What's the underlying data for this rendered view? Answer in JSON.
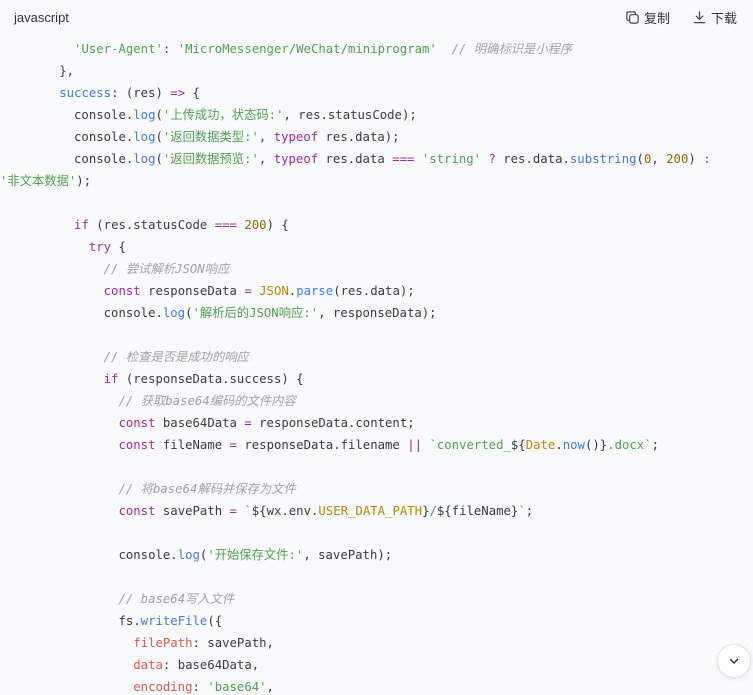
{
  "header": {
    "language": "javascript",
    "copy_label": "复制",
    "download_label": "下载"
  },
  "icons": {
    "copy": "copy-icon",
    "download": "download-icon",
    "scroll": "chevron-down-icon"
  },
  "code_lines": [
    [
      {
        "t": "          "
      },
      {
        "t": "'User-Agent'",
        "c": "s"
      },
      {
        "t": ": "
      },
      {
        "t": "'MicroMessenger/WeChat/miniprogram'",
        "c": "s"
      },
      {
        "t": "  "
      },
      {
        "t": "// 明确标识是小程序",
        "c": "c"
      }
    ],
    [
      {
        "t": "        },"
      }
    ],
    [
      {
        "t": "        "
      },
      {
        "t": "success",
        "c": "f"
      },
      {
        "t": ": (res) "
      },
      {
        "t": "=>",
        "c": "k"
      },
      {
        "t": " {"
      }
    ],
    [
      {
        "t": "          console."
      },
      {
        "t": "log",
        "c": "f"
      },
      {
        "t": "("
      },
      {
        "t": "'上传成功，状态码:'",
        "c": "s"
      },
      {
        "t": ", res.statusCode);"
      }
    ],
    [
      {
        "t": "          console."
      },
      {
        "t": "log",
        "c": "f"
      },
      {
        "t": "("
      },
      {
        "t": "'返回数据类型:'",
        "c": "s"
      },
      {
        "t": ", "
      },
      {
        "t": "typeof",
        "c": "k"
      },
      {
        "t": " res.data);"
      }
    ],
    [
      {
        "t": "          console."
      },
      {
        "t": "log",
        "c": "f"
      },
      {
        "t": "("
      },
      {
        "t": "'返回数据预览:'",
        "c": "s"
      },
      {
        "t": ", "
      },
      {
        "t": "typeof",
        "c": "k"
      },
      {
        "t": " res.data "
      },
      {
        "t": "===",
        "c": "k"
      },
      {
        "t": " "
      },
      {
        "t": "'string'",
        "c": "s"
      },
      {
        "t": " "
      },
      {
        "t": "?",
        "c": "k"
      },
      {
        "t": " res.data."
      },
      {
        "t": "substring",
        "c": "f"
      },
      {
        "t": "("
      },
      {
        "t": "0",
        "c": "n"
      },
      {
        "t": ", "
      },
      {
        "t": "200",
        "c": "n"
      },
      {
        "t": ") "
      },
      {
        "t": ":",
        "c": "k"
      }
    ],
    [
      {
        "t": "'非文本数据'",
        "c": "s"
      },
      {
        "t": ");"
      }
    ],
    [
      {
        "t": ""
      }
    ],
    [
      {
        "t": "          "
      },
      {
        "t": "if",
        "c": "k"
      },
      {
        "t": " (res.statusCode "
      },
      {
        "t": "===",
        "c": "k"
      },
      {
        "t": " "
      },
      {
        "t": "200",
        "c": "n"
      },
      {
        "t": ") {"
      }
    ],
    [
      {
        "t": "            "
      },
      {
        "t": "try",
        "c": "k"
      },
      {
        "t": " {"
      }
    ],
    [
      {
        "t": "              "
      },
      {
        "t": "// 尝试解析JSON响应",
        "c": "c"
      }
    ],
    [
      {
        "t": "              "
      },
      {
        "t": "const",
        "c": "k"
      },
      {
        "t": " responseData "
      },
      {
        "t": "=",
        "c": "k"
      },
      {
        "t": " "
      },
      {
        "t": "JSON",
        "c": "pr"
      },
      {
        "t": "."
      },
      {
        "t": "parse",
        "c": "f"
      },
      {
        "t": "(res.data);"
      }
    ],
    [
      {
        "t": "              console."
      },
      {
        "t": "log",
        "c": "f"
      },
      {
        "t": "("
      },
      {
        "t": "'解析后的JSON响应:'",
        "c": "s"
      },
      {
        "t": ", responseData);"
      }
    ],
    [
      {
        "t": ""
      }
    ],
    [
      {
        "t": "              "
      },
      {
        "t": "// 检查是否是成功的响应",
        "c": "c"
      }
    ],
    [
      {
        "t": "              "
      },
      {
        "t": "if",
        "c": "k"
      },
      {
        "t": " (responseData.success) {"
      }
    ],
    [
      {
        "t": "                "
      },
      {
        "t": "// 获取base64编码的文件内容",
        "c": "c"
      }
    ],
    [
      {
        "t": "                "
      },
      {
        "t": "const",
        "c": "k"
      },
      {
        "t": " base64Data "
      },
      {
        "t": "=",
        "c": "k"
      },
      {
        "t": " responseData.content;"
      }
    ],
    [
      {
        "t": "                "
      },
      {
        "t": "const",
        "c": "k"
      },
      {
        "t": " fileName "
      },
      {
        "t": "=",
        "c": "k"
      },
      {
        "t": " responseData.filename "
      },
      {
        "t": "||",
        "c": "k"
      },
      {
        "t": " "
      },
      {
        "t": "`converted_",
        "c": "s"
      },
      {
        "t": "${"
      },
      {
        "t": "Date",
        "c": "pr"
      },
      {
        "t": "."
      },
      {
        "t": "now",
        "c": "f"
      },
      {
        "t": "()}"
      },
      {
        "t": ".docx`",
        "c": "s"
      },
      {
        "t": ";"
      }
    ],
    [
      {
        "t": ""
      }
    ],
    [
      {
        "t": "                "
      },
      {
        "t": "// 将base64解码并保存为文件",
        "c": "c"
      }
    ],
    [
      {
        "t": "                "
      },
      {
        "t": "const",
        "c": "k"
      },
      {
        "t": " savePath "
      },
      {
        "t": "=",
        "c": "k"
      },
      {
        "t": " "
      },
      {
        "t": "`",
        "c": "s"
      },
      {
        "t": "${wx.env."
      },
      {
        "t": "USER_DATA_PATH",
        "c": "pr"
      },
      {
        "t": "}"
      },
      {
        "t": "/",
        "c": "s"
      },
      {
        "t": "${fileName}"
      },
      {
        "t": "`",
        "c": "s"
      },
      {
        "t": ";"
      }
    ],
    [
      {
        "t": ""
      }
    ],
    [
      {
        "t": "                console."
      },
      {
        "t": "log",
        "c": "f"
      },
      {
        "t": "("
      },
      {
        "t": "'开始保存文件:'",
        "c": "s"
      },
      {
        "t": ", savePath);"
      }
    ],
    [
      {
        "t": ""
      }
    ],
    [
      {
        "t": "                "
      },
      {
        "t": "// base64写入文件",
        "c": "c"
      }
    ],
    [
      {
        "t": "                fs."
      },
      {
        "t": "writeFile",
        "c": "f"
      },
      {
        "t": "({"
      }
    ],
    [
      {
        "t": "                  "
      },
      {
        "t": "filePath",
        "c": "p"
      },
      {
        "t": ": savePath,"
      }
    ],
    [
      {
        "t": "                  "
      },
      {
        "t": "data",
        "c": "p"
      },
      {
        "t": ": base64Data,"
      }
    ],
    [
      {
        "t": "                  "
      },
      {
        "t": "encoding",
        "c": "p"
      },
      {
        "t": ": "
      },
      {
        "t": "'base64'",
        "c": "s"
      },
      {
        "t": ","
      }
    ]
  ]
}
